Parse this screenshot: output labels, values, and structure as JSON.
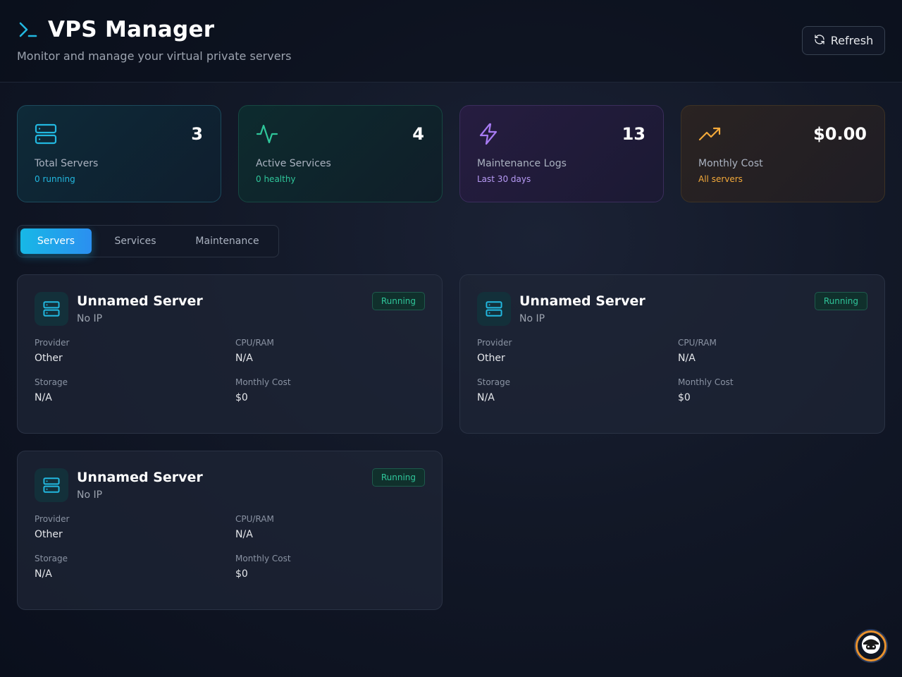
{
  "header": {
    "title": "VPS Manager",
    "subtitle": "Monitor and manage your virtual private servers",
    "refresh_label": "Refresh"
  },
  "stats": [
    {
      "value": "3",
      "label": "Total Servers",
      "sub": "0 running",
      "icon": "server-icon",
      "color": "#22b8e0"
    },
    {
      "value": "4",
      "label": "Active Services",
      "sub": "0 healthy",
      "icon": "activity-icon",
      "color": "#2fc69a"
    },
    {
      "value": "13",
      "label": "Maintenance Logs",
      "sub": "Last 30 days",
      "icon": "lightning-icon",
      "color": "#a77bf3"
    },
    {
      "value": "$0.00",
      "label": "Monthly Cost",
      "sub": "All servers",
      "icon": "trending-up-icon",
      "color": "#f3a93a"
    }
  ],
  "tabs": [
    {
      "label": "Servers",
      "active": true
    },
    {
      "label": "Services",
      "active": false
    },
    {
      "label": "Maintenance",
      "active": false
    }
  ],
  "servers": [
    {
      "name": "Unnamed Server",
      "ip": "No IP",
      "status": "Running",
      "fields": {
        "provider_label": "Provider",
        "provider": "Other",
        "cpuram_label": "CPU/RAM",
        "cpuram": "N/A",
        "storage_label": "Storage",
        "storage": "N/A",
        "cost_label": "Monthly Cost",
        "cost": "$0"
      }
    },
    {
      "name": "Unnamed Server",
      "ip": "No IP",
      "status": "Running",
      "fields": {
        "provider_label": "Provider",
        "provider": "Other",
        "cpuram_label": "CPU/RAM",
        "cpuram": "N/A",
        "storage_label": "Storage",
        "storage": "N/A",
        "cost_label": "Monthly Cost",
        "cost": "$0"
      }
    },
    {
      "name": "Unnamed Server",
      "ip": "No IP",
      "status": "Running",
      "fields": {
        "provider_label": "Provider",
        "provider": "Other",
        "cpuram_label": "CPU/RAM",
        "cpuram": "N/A",
        "storage_label": "Storage",
        "storage": "N/A",
        "cost_label": "Monthly Cost",
        "cost": "$0"
      }
    }
  ],
  "colors": {
    "accent": "#22b8e0",
    "running": "#2fc69a"
  }
}
